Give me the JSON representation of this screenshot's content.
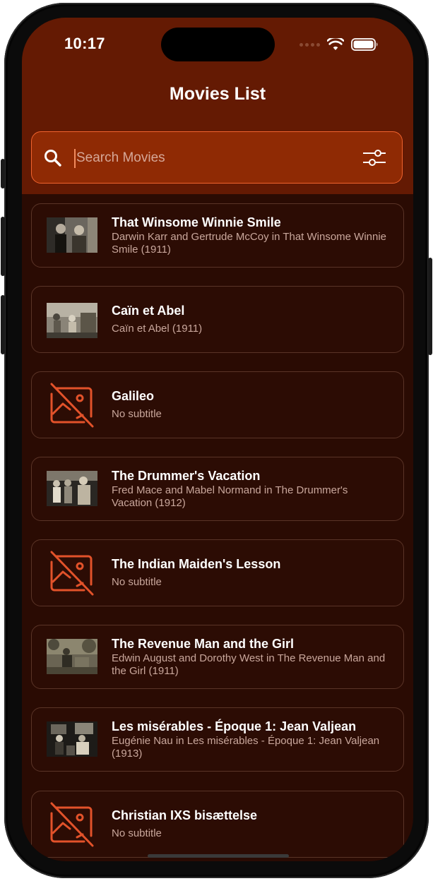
{
  "status_bar": {
    "time": "10:17"
  },
  "screen_title": "Movies List",
  "search": {
    "placeholder": "Search Movies",
    "value": ""
  },
  "colors": {
    "header": "#641a03",
    "background": "#2a0b03",
    "accent": "#e2522a",
    "search_bg": "#8f2a04"
  },
  "movies": [
    {
      "title": "That Winsome Winnie Smile",
      "subtitle": "Darwin Karr and Gertrude McCoy in That Winsome Winnie Smile (1911)",
      "has_image": true
    },
    {
      "title": "Caïn et Abel",
      "subtitle": "Caïn et Abel (1911)",
      "has_image": true
    },
    {
      "title": "Galileo",
      "subtitle": "No subtitle",
      "has_image": false
    },
    {
      "title": "The Drummer's Vacation",
      "subtitle": "Fred Mace and Mabel Normand in The Drummer's Vacation (1912)",
      "has_image": true
    },
    {
      "title": "The Indian Maiden's Lesson",
      "subtitle": "No subtitle",
      "has_image": false
    },
    {
      "title": "The Revenue Man and the Girl",
      "subtitle": "Edwin August and Dorothy West in The Revenue Man and the Girl (1911)",
      "has_image": true
    },
    {
      "title": "Les misérables - Époque 1: Jean Valjean",
      "subtitle": "Eugénie Nau in Les misérables - Époque 1: Jean Valjean (1913)",
      "has_image": true
    },
    {
      "title": "Christian IXS bisættelse",
      "subtitle": "No subtitle",
      "has_image": false
    }
  ]
}
